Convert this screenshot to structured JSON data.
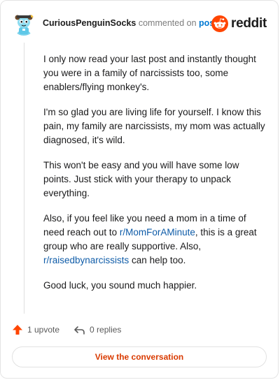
{
  "header": {
    "username": "CuriousPenguinSocks",
    "action_text": "commented on",
    "link_text": "post",
    "brand": "reddit"
  },
  "comment": {
    "paragraph_1": "I only now read your last post and instantly thought you were in a family of narcissists too, some enablers/flying monkey's.",
    "paragraph_2": "I'm so glad you are living life for yourself. I know this pain, my family are narcissists, my mom was actually diagnosed, it's wild.",
    "paragraph_3": "This won't be easy and you will have some low points. Just stick with your therapy to unpack everything.",
    "paragraph_4_part1": "Also, if you feel like you need a mom in a time of need reach out to ",
    "subreddit_1": "r/MomForAMinute",
    "paragraph_4_part2": ", this is a great group who are really supportive. Also, ",
    "subreddit_2": "r/raisedbynarcissists",
    "paragraph_4_part3": " can help too.",
    "paragraph_5": "Good luck, you sound much happier."
  },
  "actions": {
    "upvotes": "1 upvote",
    "replies": "0 replies"
  },
  "cta_label": "View the conversation",
  "colors": {
    "upvote": "#ff4500",
    "link": "#0079d3",
    "cta": "#d93a00"
  },
  "icons": {
    "brand": "reddit-snoo-icon",
    "upvote": "upvote-arrow-icon",
    "reply": "reply-arrow-icon"
  }
}
